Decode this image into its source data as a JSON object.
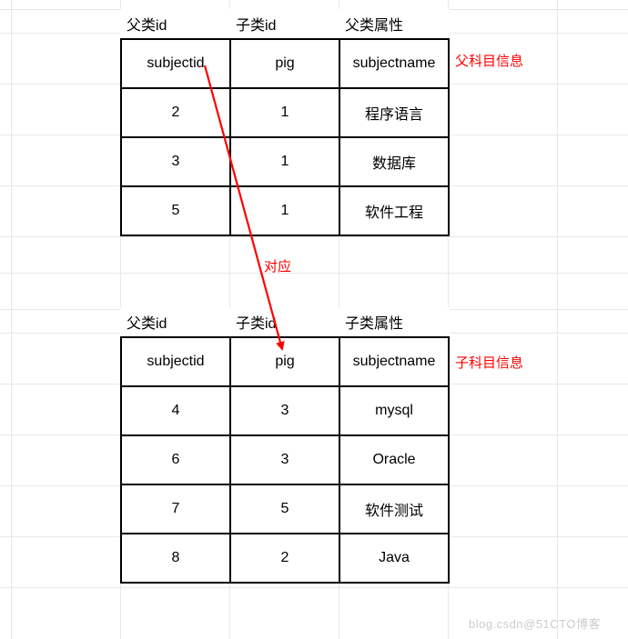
{
  "headers": {
    "col1": "父类id",
    "col2": "子类id",
    "col3_parent": "父类属性",
    "col3_child": "子类属性"
  },
  "annotations": {
    "parent_info": "父科目信息",
    "child_info": "子科目信息",
    "correspond": "对应"
  },
  "chart_data": [
    {
      "type": "table",
      "title": "父科目信息",
      "columns": [
        "父类id",
        "子类id",
        "父类属性"
      ],
      "rows": [
        {
          "col1": "subjectid",
          "col2": "pig",
          "col3": "subjectname"
        },
        {
          "col1": "2",
          "col2": "1",
          "col3": "程序语言"
        },
        {
          "col1": "3",
          "col2": "1",
          "col3": "数据库"
        },
        {
          "col1": "5",
          "col2": "1",
          "col3": "软件工程"
        }
      ]
    },
    {
      "type": "table",
      "title": "子科目信息",
      "columns": [
        "父类id",
        "子类id",
        "子类属性"
      ],
      "rows": [
        {
          "col1": "subjectid",
          "col2": "pig",
          "col3": "subjectname"
        },
        {
          "col1": "4",
          "col2": "3",
          "col3": "mysql"
        },
        {
          "col1": "6",
          "col2": "3",
          "col3": "Oracle"
        },
        {
          "col1": "7",
          "col2": "5",
          "col3": "软件测试"
        },
        {
          "col1": "8",
          "col2": "2",
          "col3": "Java"
        }
      ]
    }
  ],
  "arrow": {
    "label": "对应",
    "from": "parent.pig",
    "to": "child.pig"
  },
  "watermark": "blog.csdn@51CTO博客"
}
